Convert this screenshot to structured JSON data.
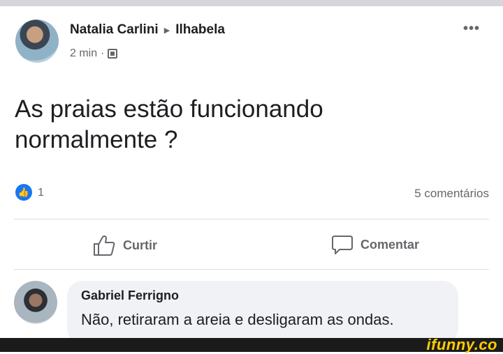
{
  "post": {
    "author": "Natalia Carlini",
    "location": "Ilhabela",
    "timestamp": "2 min",
    "separator": "·",
    "privacy_icon": "album-icon",
    "text_line1": "As praias estão funcionando",
    "text_line2": "normalmente ?",
    "like_count": "1",
    "comment_count": "5 comentários"
  },
  "actions": {
    "like_label": "Curtir",
    "comment_label": "Comentar"
  },
  "comment": {
    "author": "Gabriel Ferrigno",
    "text": "Não, retiraram a areia e desligaram as ondas."
  },
  "watermark": {
    "text": "ifunny.co"
  },
  "colors": {
    "accent": "#1877f2",
    "watermark": "#ffcc00"
  }
}
